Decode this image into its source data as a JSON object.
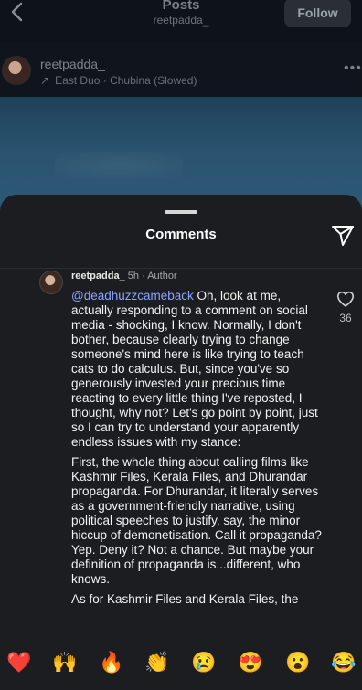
{
  "post_view": {
    "title": "Posts",
    "subtitle": "reetpadda_",
    "follow_label": "Follow",
    "username": "reetpadda_",
    "audio": "East Duo · Chubina (Slowed)"
  },
  "sheet": {
    "title": "Comments"
  },
  "comment": {
    "username": "reetpadda_",
    "time": "5h",
    "role": "Author",
    "mention": "@deadhuzzcameback",
    "paragraph1": " Oh, look at me, actually responding to a comment on social media - shocking, I know. Normally, I don't bother, because clearly trying to change someone's mind here is like trying to teach cats to do calculus. But, since you've so generously invested your precious time reacting to every little thing I've reposted, I thought, why not? Let's go point by point, just so I can try to understand your apparently endless issues with my stance:",
    "paragraph2": "First, the whole thing about calling films like Kashmir Files, Kerala Files, and Dhurandar propaganda. For Dhurandar, it literally serves as a government-friendly narrative, using political speeches to justify, say, the minor hiccup of demonetisation. Call it propaganda? Yep. Deny it? Not a chance. But maybe your definition of propaganda is...different, who knows.",
    "paragraph3": "As for Kashmir Files and Kerala Files, the",
    "like_count": "36"
  },
  "emoji_bar": [
    "❤️",
    "🙌",
    "🔥",
    "👏",
    "😢",
    "😍",
    "😮",
    "😂"
  ],
  "icons": {
    "back": "chevron-left-icon",
    "more": "more-horizontal-icon",
    "share": "paper-plane-icon",
    "like": "heart-outline-icon"
  }
}
